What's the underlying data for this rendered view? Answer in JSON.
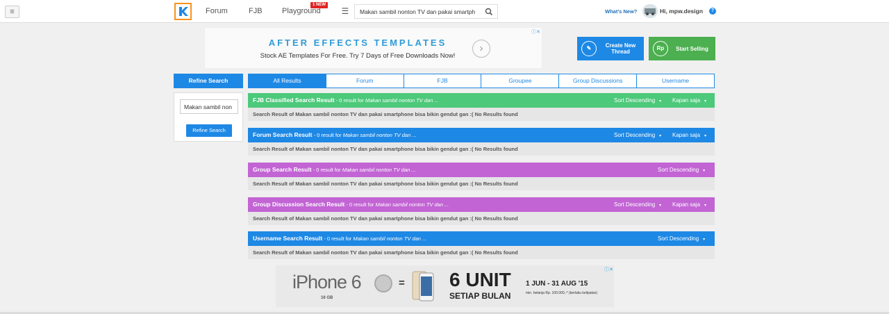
{
  "nav": {
    "menu_icon": "hamburger-icon",
    "forum": "Forum",
    "fjb": "FJB",
    "playground": "Playground",
    "new_badge": "1 NEW",
    "search_value": "Makan sambil nonton TV dan pakai smartph",
    "whats_new": "What's New?",
    "user": "Hi, mpw.design",
    "help": "?",
    "brand_color": "#1e88e5",
    "logo_border": "#f7941d"
  },
  "ad_top": {
    "title": "AFTER EFFECTS TEMPLATES",
    "subtitle": "Stock AE Templates For Free. Try 7 Days of Free Downloads Now!",
    "info": "ⓘ✕"
  },
  "actions": {
    "create_thread": "Create New Thread",
    "create_icon_text": "✎",
    "start_selling": "Start Selling",
    "sell_icon_text": "Rp"
  },
  "refine": {
    "title": "Refine Search",
    "input_value": "Makan sambil non",
    "button": "Refine Search"
  },
  "tabs": [
    "All Results",
    "Forum",
    "FJB",
    "Groupee",
    "Group Discussions",
    "Username"
  ],
  "sections": [
    {
      "title": "FJB Classified Search Result",
      "count": " - 0 result for ",
      "query": "Makan sambil nonton TV dan ...",
      "sort": "Sort Descending",
      "time": "Kapan saja",
      "body": "Search Result of Makan sambil nonton TV dan pakai smartphone bisa bikin gendut gan :( No Results found",
      "color": "#4cc97a"
    },
    {
      "title": "Forum Search Result",
      "count": " - 0 result for ",
      "query": "Makan sambil nonton TV dan ...",
      "sort": "Sort Descending",
      "time": "Kapan saja",
      "body": "Search Result of Makan sambil nonton TV dan pakai smartphone bisa bikin gendut gan :( No Results found",
      "color": "#1e88e5"
    },
    {
      "title": "Group Search Result",
      "count": " - 0 result for ",
      "query": "Makan sambil nonton TV dan ...",
      "sort": "Sort Descending",
      "time": "",
      "body": "Search Result of Makan sambil nonton TV dan pakai smartphone bisa bikin gendut gan :( No Results found",
      "color": "#c264d4"
    },
    {
      "title": "Group Discussion Search Result",
      "count": " - 0 result for ",
      "query": "Makan sambil nonton TV dan ...",
      "sort": "Sort Descending",
      "time": "Kapan saja",
      "body": "Search Result of Makan sambil nonton TV dan pakai smartphone bisa bikin gendut gan :( No Results found",
      "color": "#c264d4"
    },
    {
      "title": "Username Search Result",
      "count": " - 0 result for ",
      "query": "Makan sambil nonton TV dan ...",
      "sort": "Sort Descending",
      "time": "",
      "body": "Search Result of Makan sambil nonton TV dan pakai smartphone bisa bikin gendut gan :( No Results found",
      "color": "#1e88e5"
    }
  ],
  "ad_bottom": {
    "product": "iPhone 6",
    "storage": "16 GB",
    "equals": "=",
    "units": "6 UNIT",
    "per": "SETIAP BULAN",
    "dates": "1 JUN - 31 AUG '15",
    "fine": "min. belanja Rp. 100.000,-* (berlaku kelipatan)",
    "info": "ⓘ✕"
  }
}
